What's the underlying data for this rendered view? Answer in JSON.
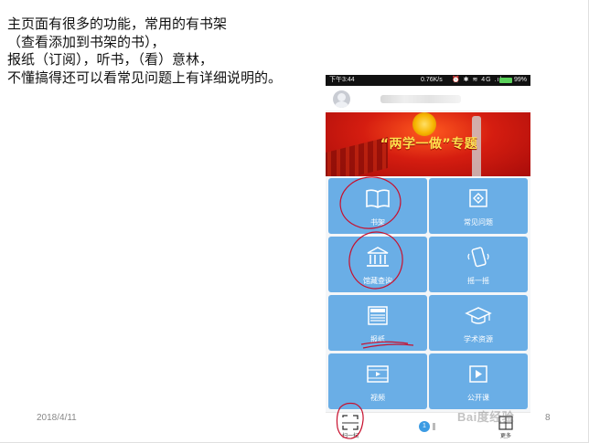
{
  "slide": {
    "notes": [
      "主页面有很多的功能，常用的有书架",
      "（查看添加到书架的书），",
      "报纸（订阅），听书，（看）意林，",
      "不懂搞得还可以看常见问题上有详细说明的。"
    ],
    "date": "2018/4/11",
    "page_number": "8"
  },
  "phone": {
    "status_bar": {
      "time": "下午3:44",
      "speed": "0.76K/s",
      "icons": "⏰ ✱ ≋ 4G .ıl",
      "battery": "99%"
    },
    "banner": {
      "title": "“两学一做”专题"
    },
    "tiles": [
      {
        "label": "书架",
        "icon": "book-icon"
      },
      {
        "label": "常见问题",
        "icon": "help-icon"
      },
      {
        "label": "馆藏查询",
        "icon": "library-icon"
      },
      {
        "label": "摇一摇",
        "icon": "shake-phone-icon"
      },
      {
        "label": "报纸",
        "icon": "newspaper-icon"
      },
      {
        "label": "学术资源",
        "icon": "graduation-cap-icon"
      },
      {
        "label": "视频",
        "icon": "film-icon"
      },
      {
        "label": "公开课",
        "icon": "play-icon"
      }
    ],
    "bottom_nav": {
      "left_label": "扫一扫",
      "center_badge": "1",
      "right_label": "更多"
    }
  },
  "watermark": "Bai度经验",
  "colors": {
    "tile": "#6aaee6",
    "banner": "#d51d10",
    "banner_text": "#ffe14d",
    "annotation": "#c8102e"
  }
}
